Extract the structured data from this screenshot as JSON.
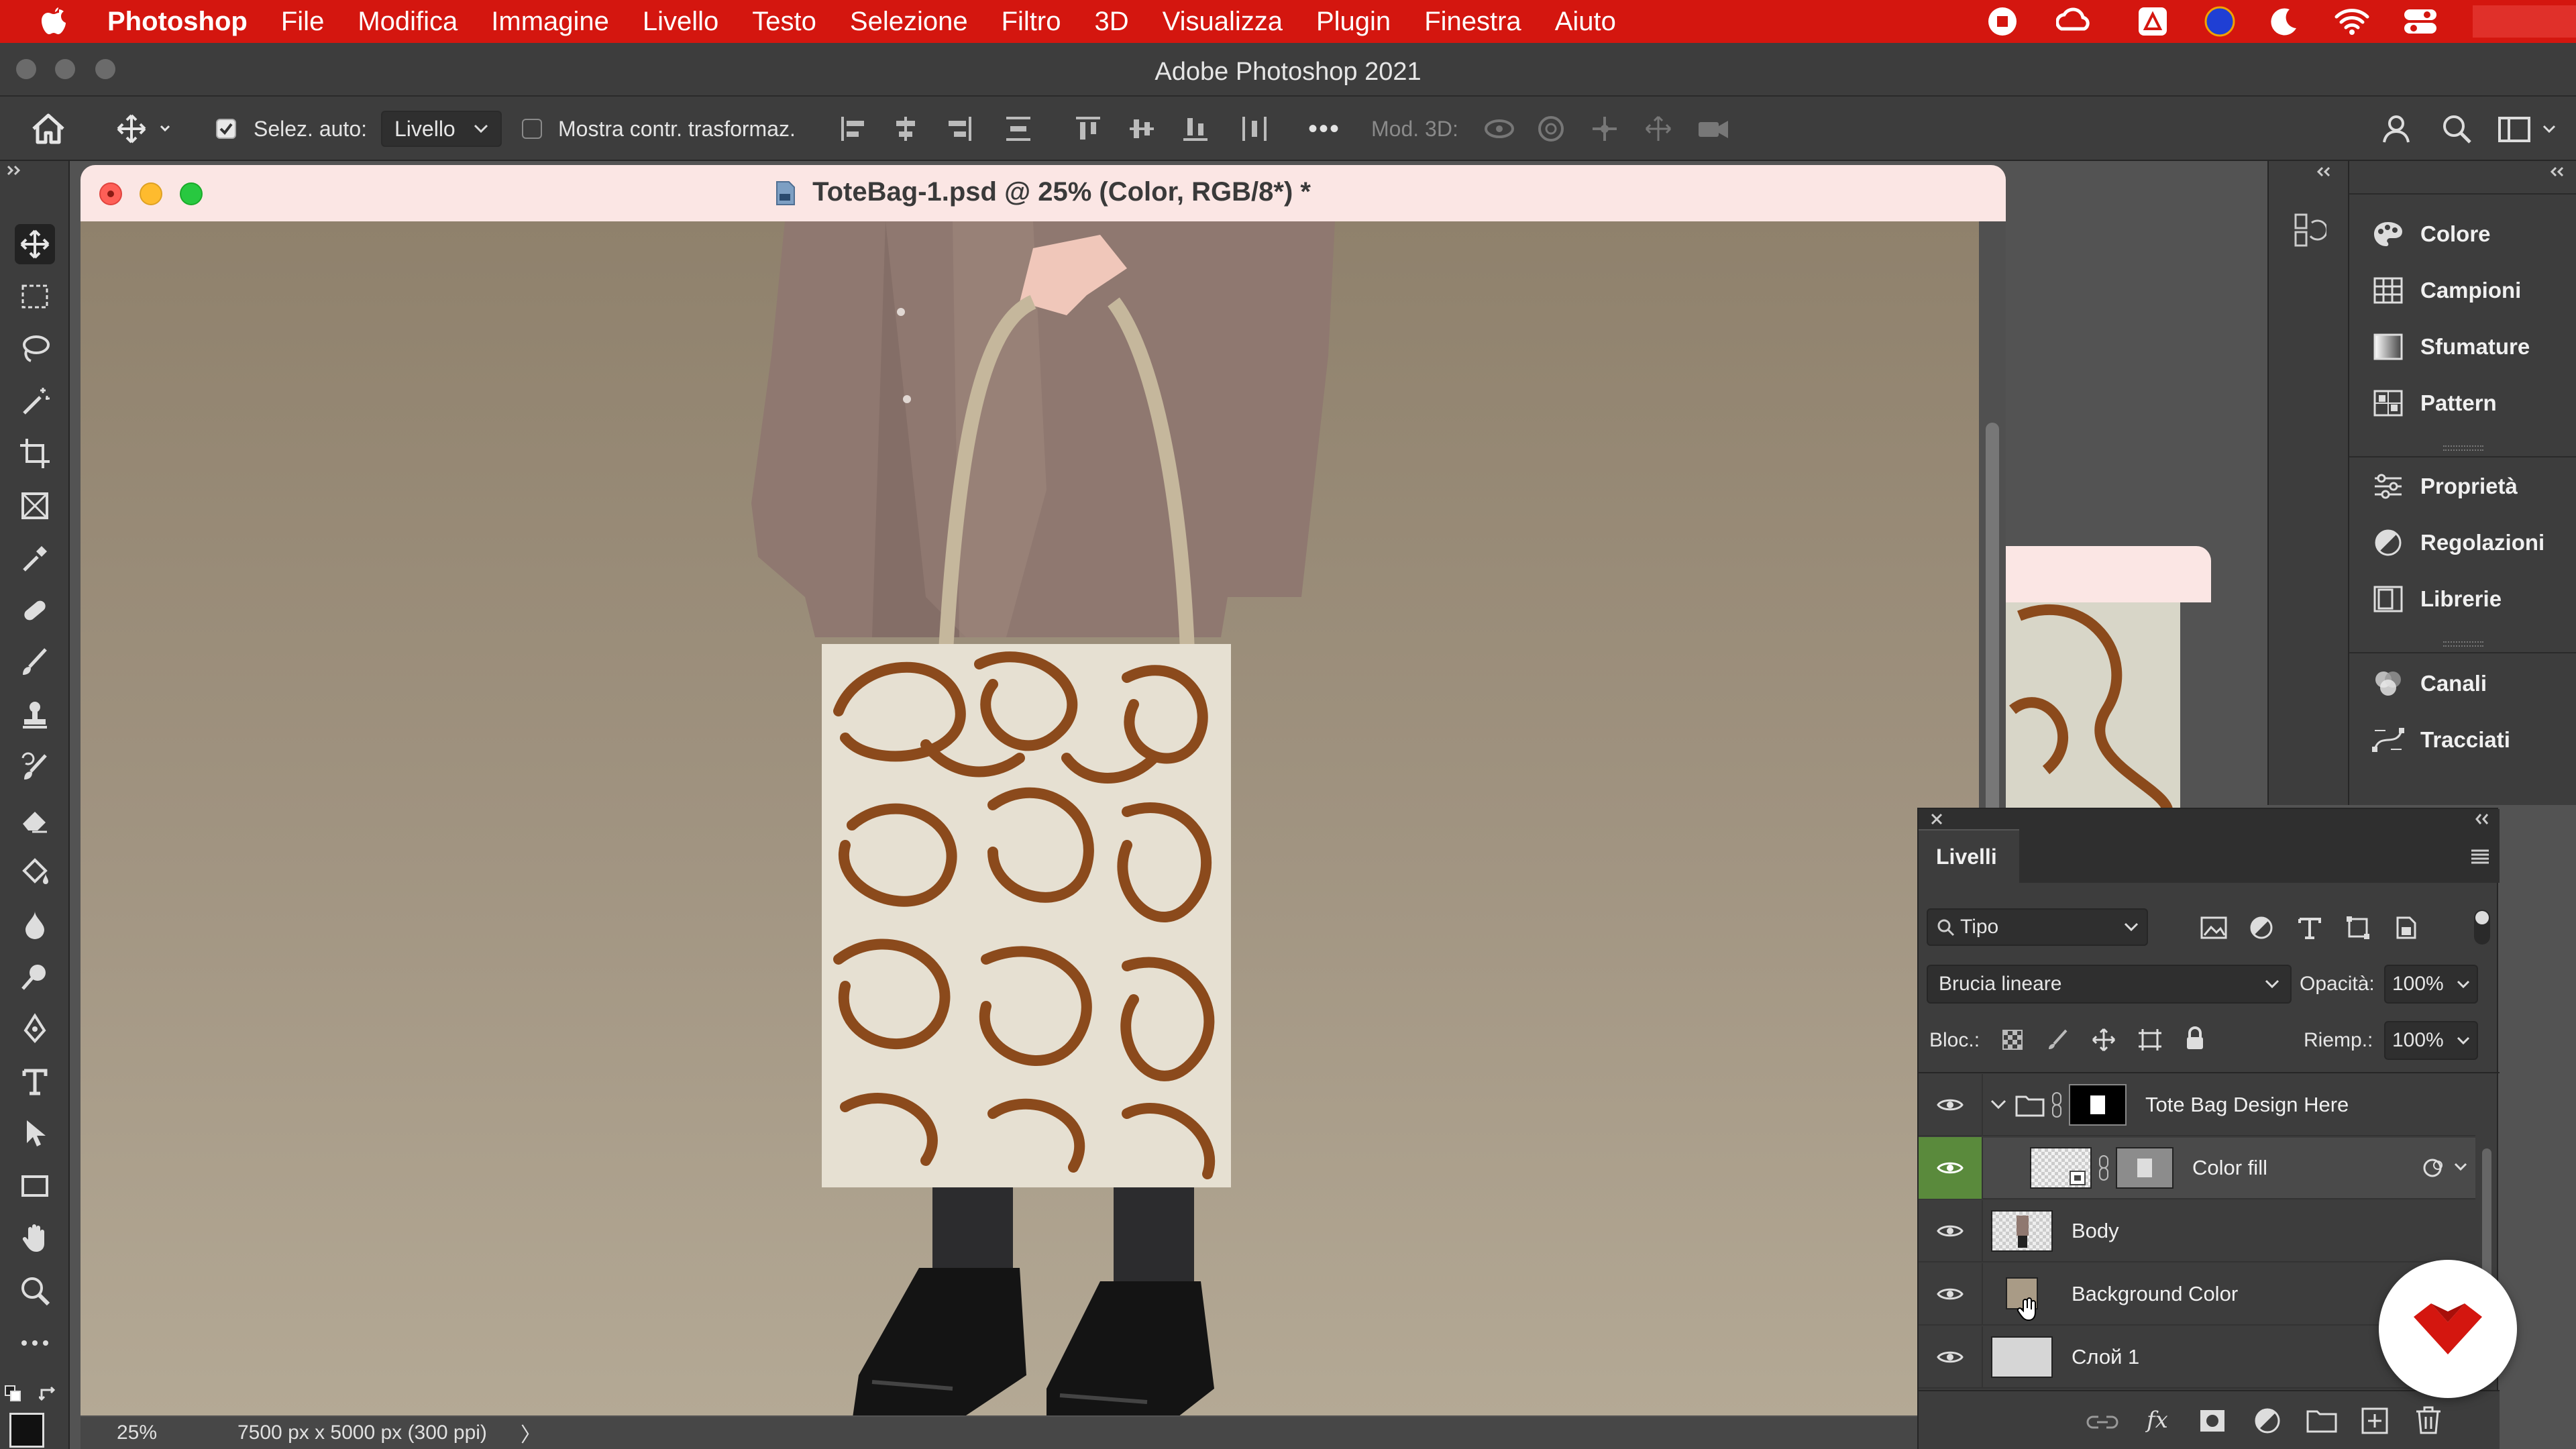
{
  "menubar": {
    "apple": "",
    "app_name": "Photoshop",
    "items": [
      "File",
      "Modifica",
      "Immagine",
      "Livello",
      "Testo",
      "Selezione",
      "Filtro",
      "3D",
      "Visualizza",
      "Plugin",
      "Finestra",
      "Aiuto"
    ]
  },
  "window": {
    "title": "Adobe Photoshop 2021"
  },
  "options_bar": {
    "auto_select_label": "Selez. auto:",
    "auto_select_checked": true,
    "auto_select_target": "Livello",
    "show_transform_label": "Mostra contr. trasformaz.",
    "show_transform_checked": false,
    "more_label": "•••",
    "mode_3d_label": "Mod. 3D:"
  },
  "document": {
    "title": "ToteBag-1.psd @ 25% (Color, RGB/8*) *",
    "zoom": "25%",
    "info": "7500 px x 5000 px (300 ppi)",
    "info_arrow": "〉"
  },
  "dock": {
    "items": [
      {
        "label": "Colore",
        "icon": "palette-icon"
      },
      {
        "label": "Campioni",
        "icon": "swatches-grid-icon"
      },
      {
        "label": "Sfumature",
        "icon": "gradient-icon"
      },
      {
        "label": "Pattern",
        "icon": "pattern-icon"
      },
      {
        "label": "Proprietà",
        "icon": "sliders-icon"
      },
      {
        "label": "Regolazioni",
        "icon": "adjustments-icon"
      },
      {
        "label": "Librerie",
        "icon": "libraries-icon"
      },
      {
        "label": "Canali",
        "icon": "channels-icon"
      },
      {
        "label": "Tracciati",
        "icon": "paths-icon"
      }
    ]
  },
  "layers_panel": {
    "tab": "Livelli",
    "filter_kind": "Tipo",
    "blend_mode": "Brucia lineare",
    "opacity_label": "Opacità:",
    "opacity_value": "100%",
    "lock_label": "Bloc.:",
    "fill_label": "Riemp.:",
    "fill_value": "100%",
    "layers": [
      {
        "name": "Tote Bag Design Here",
        "type": "group",
        "visible": true
      },
      {
        "name": "Color fill",
        "type": "smart-object",
        "visible": true,
        "selected": true
      },
      {
        "name": "Body",
        "type": "pixel",
        "visible": true
      },
      {
        "name": "Background Color",
        "type": "pixel",
        "visible": true
      },
      {
        "name": "Слой 1",
        "type": "pixel",
        "visible": true
      }
    ]
  },
  "colors": {
    "menubar": "#d4160f",
    "canvas_bg": "#a59985",
    "doc_titlebar": "#fbe6e4",
    "selected_eye": "#5a8a3c",
    "badge_red": "#d4160f"
  }
}
